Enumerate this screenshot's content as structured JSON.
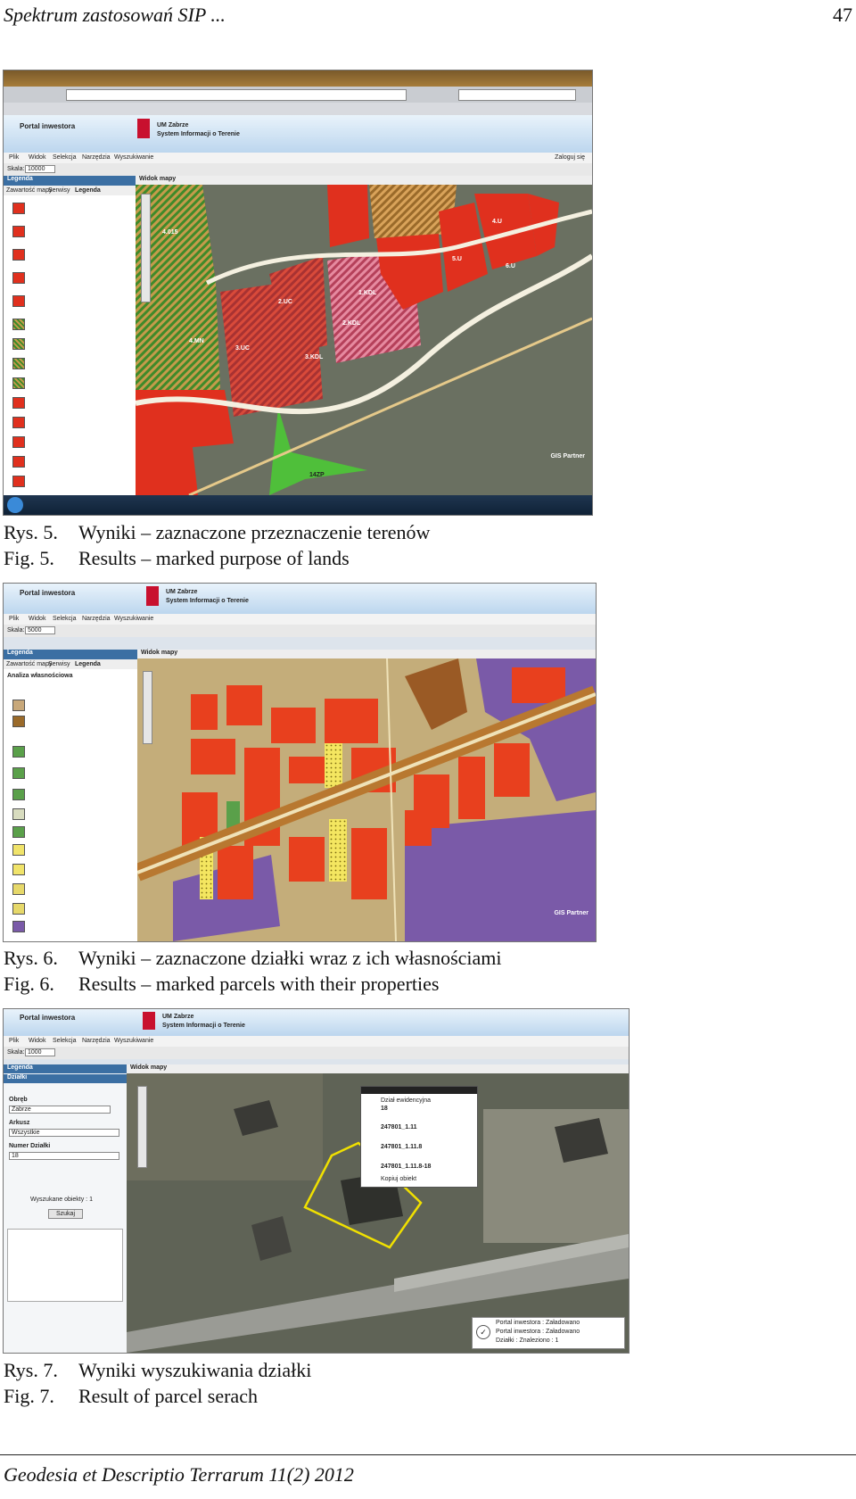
{
  "header": {
    "title": "Spektrum zastosowań SIP ...",
    "page_number": "47"
  },
  "app": {
    "portal_title": "Portal inwestora",
    "city": "UM Zabrze",
    "system": "System Informacji o Terenie",
    "menu": [
      "Plik",
      "Widok",
      "Selekcja",
      "Narzędzia",
      "Wyszukiwanie"
    ],
    "scale_label": "Skala:",
    "legend_title": "Legenda",
    "panel_tabs": [
      "Zawartość mapy",
      "Serwisy",
      "Legenda"
    ],
    "map_view_label": "Widok mapy",
    "logo": "GIS Partner",
    "login_link": "Zaloguj się"
  },
  "figures": [
    {
      "caption_pl_label": "Rys. 5.",
      "caption_pl": "Wyniki – zaznaczone przeznaczenie terenów",
      "caption_en_label": "Fig.  5.",
      "caption_en": "Results – marked purpose of lands",
      "scale_value": "10000",
      "labels": [
        "4.015",
        "3.UC",
        "2.UC",
        "1.KDL",
        "2.KDL",
        "3.KDL",
        "4.U",
        "6.U",
        "5.U",
        "14ZP",
        "4.MN"
      ]
    },
    {
      "caption_pl_label": "Rys. 6.",
      "caption_pl": "Wyniki – zaznaczone działki wraz z ich własnościami",
      "caption_en_label": "Fig. 6.",
      "caption_en": "Results – marked parcels with their properties",
      "scale_value": "5000",
      "legend_heading": "Analiza własnościowa"
    },
    {
      "caption_pl_label": "Rys. 7.",
      "caption_pl": "Wyniki wyszukiwania działki",
      "caption_en_label": "Fig. 7.",
      "caption_en": "Result of parcel serach",
      "scale_value": "1000",
      "panel_title": "Działki",
      "form": {
        "obreb_label": "Obręb",
        "obreb_value": "Zabrze",
        "arkusz_label": "Arkusz",
        "arkusz_value": "Wszystkie",
        "numer_label": "Numer Działki",
        "numer_value": "18",
        "results": "Wyszukane obiekty : 1",
        "search_btn": "Szukaj"
      },
      "popup": {
        "title": "Dział ewidencyjna",
        "value": "18",
        "rows": [
          "247801_1.11",
          "247801_1.11.8",
          "247801_1.11.8-18"
        ],
        "footer": "Kopiuj obiekt"
      },
      "status": [
        "Portal inwestora : Załadowano",
        "Portal inwestora : Załadowano",
        "Działki : Znaleziono : 1"
      ]
    }
  ],
  "footer": {
    "journal": "Geodesia et Descriptio Terrarum 11(2) 2012"
  }
}
